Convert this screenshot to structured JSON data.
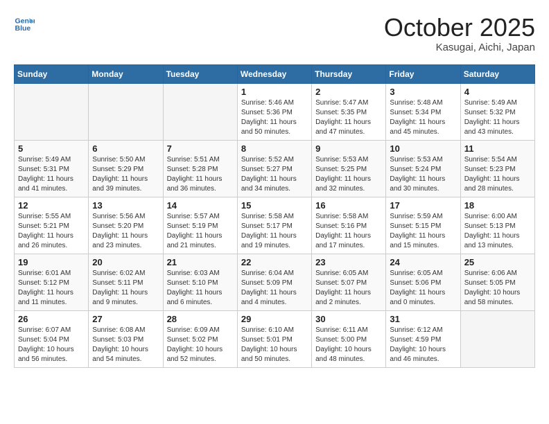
{
  "header": {
    "logo_line1": "General",
    "logo_line2": "Blue",
    "month": "October 2025",
    "location": "Kasugai, Aichi, Japan"
  },
  "weekdays": [
    "Sunday",
    "Monday",
    "Tuesday",
    "Wednesday",
    "Thursday",
    "Friday",
    "Saturday"
  ],
  "weeks": [
    [
      {
        "day": "",
        "empty": true
      },
      {
        "day": "",
        "empty": true
      },
      {
        "day": "",
        "empty": true
      },
      {
        "day": "1",
        "sunrise": "Sunrise: 5:46 AM",
        "sunset": "Sunset: 5:36 PM",
        "daylight": "Daylight: 11 hours and 50 minutes."
      },
      {
        "day": "2",
        "sunrise": "Sunrise: 5:47 AM",
        "sunset": "Sunset: 5:35 PM",
        "daylight": "Daylight: 11 hours and 47 minutes."
      },
      {
        "day": "3",
        "sunrise": "Sunrise: 5:48 AM",
        "sunset": "Sunset: 5:34 PM",
        "daylight": "Daylight: 11 hours and 45 minutes."
      },
      {
        "day": "4",
        "sunrise": "Sunrise: 5:49 AM",
        "sunset": "Sunset: 5:32 PM",
        "daylight": "Daylight: 11 hours and 43 minutes."
      }
    ],
    [
      {
        "day": "5",
        "sunrise": "Sunrise: 5:49 AM",
        "sunset": "Sunset: 5:31 PM",
        "daylight": "Daylight: 11 hours and 41 minutes."
      },
      {
        "day": "6",
        "sunrise": "Sunrise: 5:50 AM",
        "sunset": "Sunset: 5:29 PM",
        "daylight": "Daylight: 11 hours and 39 minutes."
      },
      {
        "day": "7",
        "sunrise": "Sunrise: 5:51 AM",
        "sunset": "Sunset: 5:28 PM",
        "daylight": "Daylight: 11 hours and 36 minutes."
      },
      {
        "day": "8",
        "sunrise": "Sunrise: 5:52 AM",
        "sunset": "Sunset: 5:27 PM",
        "daylight": "Daylight: 11 hours and 34 minutes."
      },
      {
        "day": "9",
        "sunrise": "Sunrise: 5:53 AM",
        "sunset": "Sunset: 5:25 PM",
        "daylight": "Daylight: 11 hours and 32 minutes."
      },
      {
        "day": "10",
        "sunrise": "Sunrise: 5:53 AM",
        "sunset": "Sunset: 5:24 PM",
        "daylight": "Daylight: 11 hours and 30 minutes."
      },
      {
        "day": "11",
        "sunrise": "Sunrise: 5:54 AM",
        "sunset": "Sunset: 5:23 PM",
        "daylight": "Daylight: 11 hours and 28 minutes."
      }
    ],
    [
      {
        "day": "12",
        "sunrise": "Sunrise: 5:55 AM",
        "sunset": "Sunset: 5:21 PM",
        "daylight": "Daylight: 11 hours and 26 minutes."
      },
      {
        "day": "13",
        "sunrise": "Sunrise: 5:56 AM",
        "sunset": "Sunset: 5:20 PM",
        "daylight": "Daylight: 11 hours and 23 minutes."
      },
      {
        "day": "14",
        "sunrise": "Sunrise: 5:57 AM",
        "sunset": "Sunset: 5:19 PM",
        "daylight": "Daylight: 11 hours and 21 minutes."
      },
      {
        "day": "15",
        "sunrise": "Sunrise: 5:58 AM",
        "sunset": "Sunset: 5:17 PM",
        "daylight": "Daylight: 11 hours and 19 minutes."
      },
      {
        "day": "16",
        "sunrise": "Sunrise: 5:58 AM",
        "sunset": "Sunset: 5:16 PM",
        "daylight": "Daylight: 11 hours and 17 minutes."
      },
      {
        "day": "17",
        "sunrise": "Sunrise: 5:59 AM",
        "sunset": "Sunset: 5:15 PM",
        "daylight": "Daylight: 11 hours and 15 minutes."
      },
      {
        "day": "18",
        "sunrise": "Sunrise: 6:00 AM",
        "sunset": "Sunset: 5:13 PM",
        "daylight": "Daylight: 11 hours and 13 minutes."
      }
    ],
    [
      {
        "day": "19",
        "sunrise": "Sunrise: 6:01 AM",
        "sunset": "Sunset: 5:12 PM",
        "daylight": "Daylight: 11 hours and 11 minutes."
      },
      {
        "day": "20",
        "sunrise": "Sunrise: 6:02 AM",
        "sunset": "Sunset: 5:11 PM",
        "daylight": "Daylight: 11 hours and 9 minutes."
      },
      {
        "day": "21",
        "sunrise": "Sunrise: 6:03 AM",
        "sunset": "Sunset: 5:10 PM",
        "daylight": "Daylight: 11 hours and 6 minutes."
      },
      {
        "day": "22",
        "sunrise": "Sunrise: 6:04 AM",
        "sunset": "Sunset: 5:09 PM",
        "daylight": "Daylight: 11 hours and 4 minutes."
      },
      {
        "day": "23",
        "sunrise": "Sunrise: 6:05 AM",
        "sunset": "Sunset: 5:07 PM",
        "daylight": "Daylight: 11 hours and 2 minutes."
      },
      {
        "day": "24",
        "sunrise": "Sunrise: 6:05 AM",
        "sunset": "Sunset: 5:06 PM",
        "daylight": "Daylight: 11 hours and 0 minutes."
      },
      {
        "day": "25",
        "sunrise": "Sunrise: 6:06 AM",
        "sunset": "Sunset: 5:05 PM",
        "daylight": "Daylight: 10 hours and 58 minutes."
      }
    ],
    [
      {
        "day": "26",
        "sunrise": "Sunrise: 6:07 AM",
        "sunset": "Sunset: 5:04 PM",
        "daylight": "Daylight: 10 hours and 56 minutes."
      },
      {
        "day": "27",
        "sunrise": "Sunrise: 6:08 AM",
        "sunset": "Sunset: 5:03 PM",
        "daylight": "Daylight: 10 hours and 54 minutes."
      },
      {
        "day": "28",
        "sunrise": "Sunrise: 6:09 AM",
        "sunset": "Sunset: 5:02 PM",
        "daylight": "Daylight: 10 hours and 52 minutes."
      },
      {
        "day": "29",
        "sunrise": "Sunrise: 6:10 AM",
        "sunset": "Sunset: 5:01 PM",
        "daylight": "Daylight: 10 hours and 50 minutes."
      },
      {
        "day": "30",
        "sunrise": "Sunrise: 6:11 AM",
        "sunset": "Sunset: 5:00 PM",
        "daylight": "Daylight: 10 hours and 48 minutes."
      },
      {
        "day": "31",
        "sunrise": "Sunrise: 6:12 AM",
        "sunset": "Sunset: 4:59 PM",
        "daylight": "Daylight: 10 hours and 46 minutes."
      },
      {
        "day": "",
        "empty": true
      }
    ]
  ]
}
